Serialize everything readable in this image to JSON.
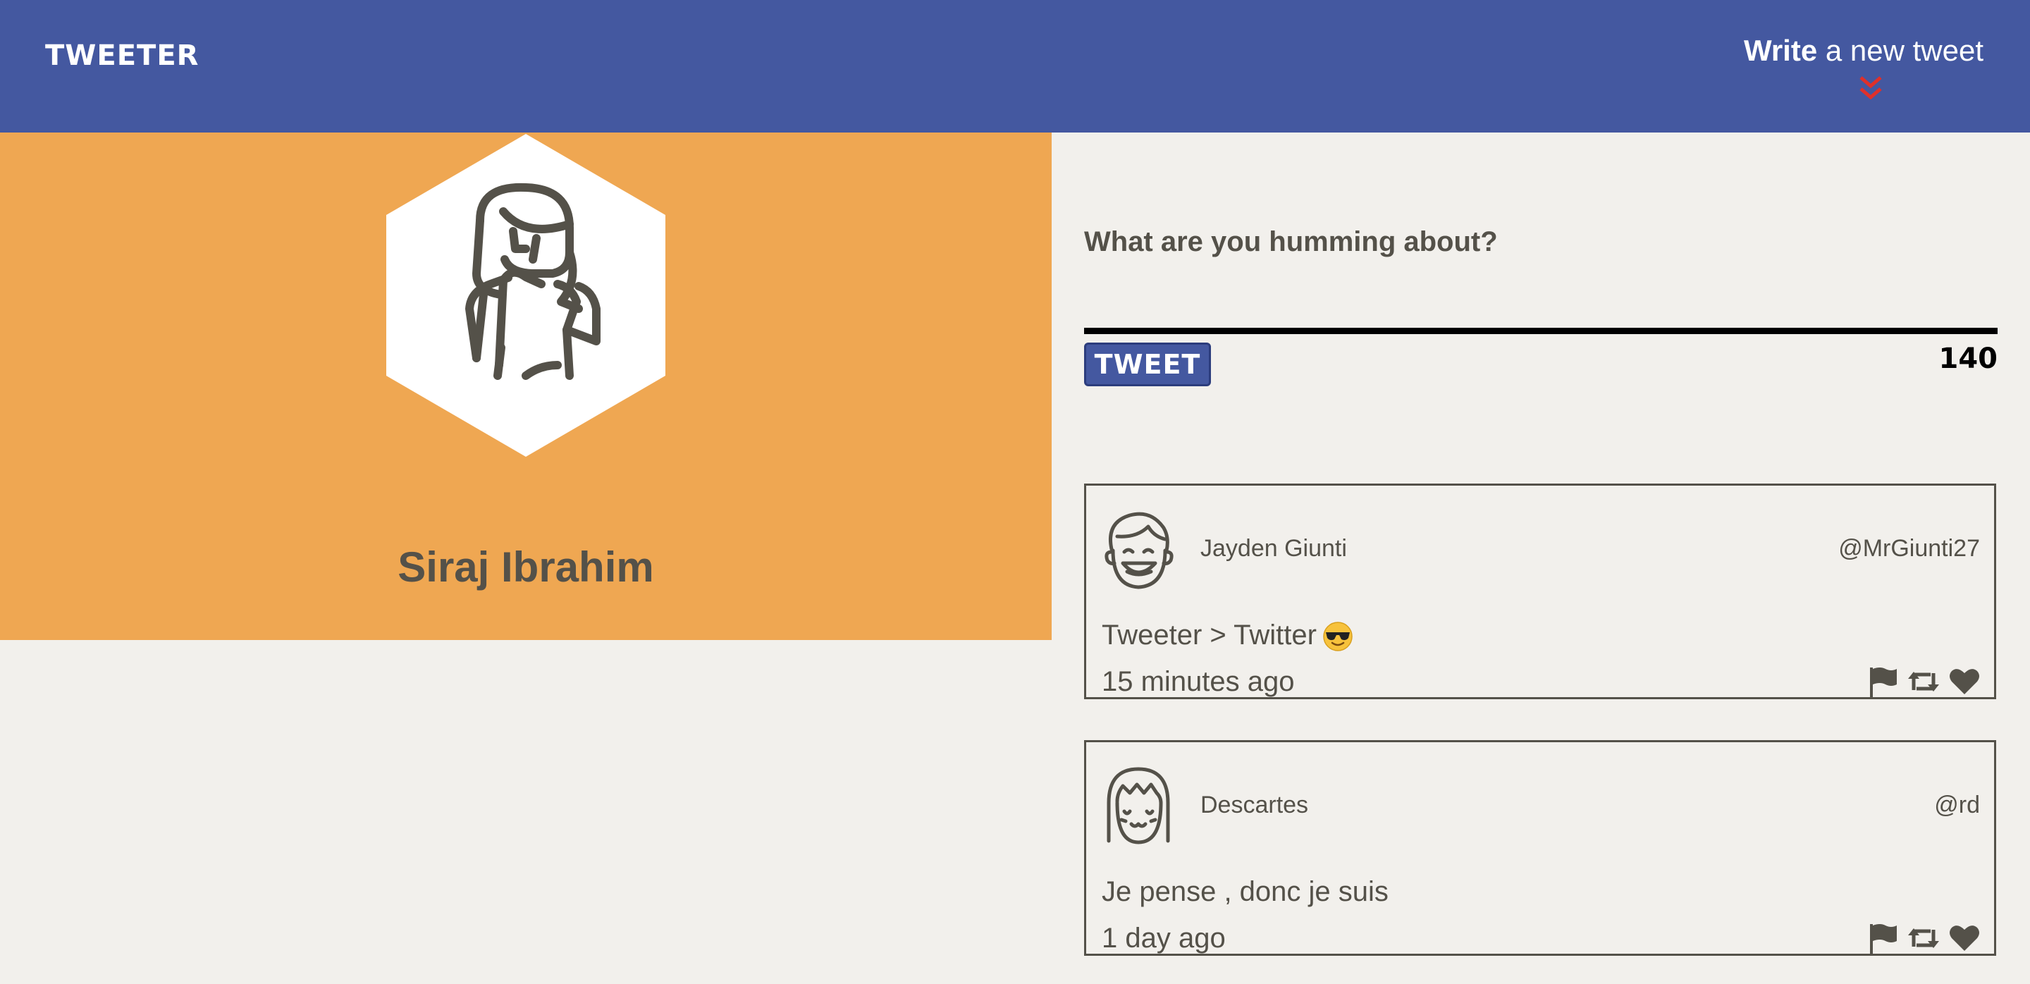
{
  "nav": {
    "brand": "TWEETER",
    "compose_bold": "Write",
    "compose_rest": " a new tweet",
    "chevron_icon": "double-chevron-down-icon",
    "colors": {
      "bar": "#4458a0",
      "chevron": "#e0302a"
    }
  },
  "profile": {
    "name": "Siraj Ibrahim",
    "avatar_icon": "woman-avatar-icon",
    "background": "#efa752"
  },
  "compose": {
    "prompt": "What are you humming about?",
    "value": "",
    "button_label": "TWEET",
    "counter": "140"
  },
  "tweets": [
    {
      "name": "Jayden Giunti",
      "handle": "@MrGiunti27",
      "text": "Tweeter > Twitter",
      "emoji_icon": "sunglasses-emoji-icon",
      "time": "15 minutes ago",
      "avatar_icon": "smiling-boy-avatar-icon"
    },
    {
      "name": "Descartes",
      "handle": "@rd",
      "text": "Je pense , donc je suis",
      "time": "1 day ago",
      "avatar_icon": "girl-bangs-avatar-icon"
    }
  ],
  "action_icons": [
    "flag-icon",
    "retweet-icon",
    "heart-icon"
  ]
}
